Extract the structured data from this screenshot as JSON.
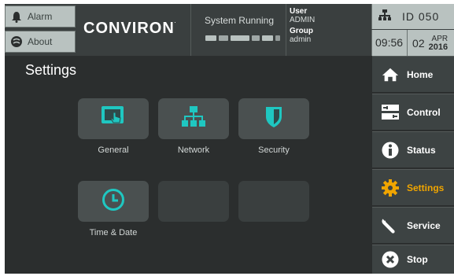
{
  "header": {
    "alarm_label": "Alarm",
    "about_label": "About",
    "logo": "CONVIRON",
    "logo_mark": ".",
    "status_text": "System Running",
    "user_label": "User",
    "user_value": "ADMIN",
    "group_label": "Group",
    "group_value": "admin",
    "id_text": "ID  050",
    "time": "09:56",
    "day": "02",
    "month": "APR",
    "year": "2016"
  },
  "main": {
    "title": "Settings",
    "tiles": [
      {
        "label": "General",
        "icon": "touch-screen-icon"
      },
      {
        "label": "Network",
        "icon": "network-icon"
      },
      {
        "label": "Security",
        "icon": "shield-icon"
      },
      {
        "label": "Time & Date",
        "icon": "clock-icon"
      }
    ]
  },
  "sidebar": {
    "items": [
      {
        "label": "Home",
        "icon": "home-icon"
      },
      {
        "label": "Control",
        "icon": "control-icon"
      },
      {
        "label": "Status",
        "icon": "info-icon"
      },
      {
        "label": "Settings",
        "icon": "gear-icon"
      },
      {
        "label": "Service",
        "icon": "wrench-icon"
      },
      {
        "label": "Stop",
        "icon": "stop-icon"
      }
    ],
    "active": "Settings"
  },
  "colors": {
    "accent_teal": "#1fc7c1",
    "active_orange": "#f0a500",
    "background": "#2b2e2e"
  }
}
